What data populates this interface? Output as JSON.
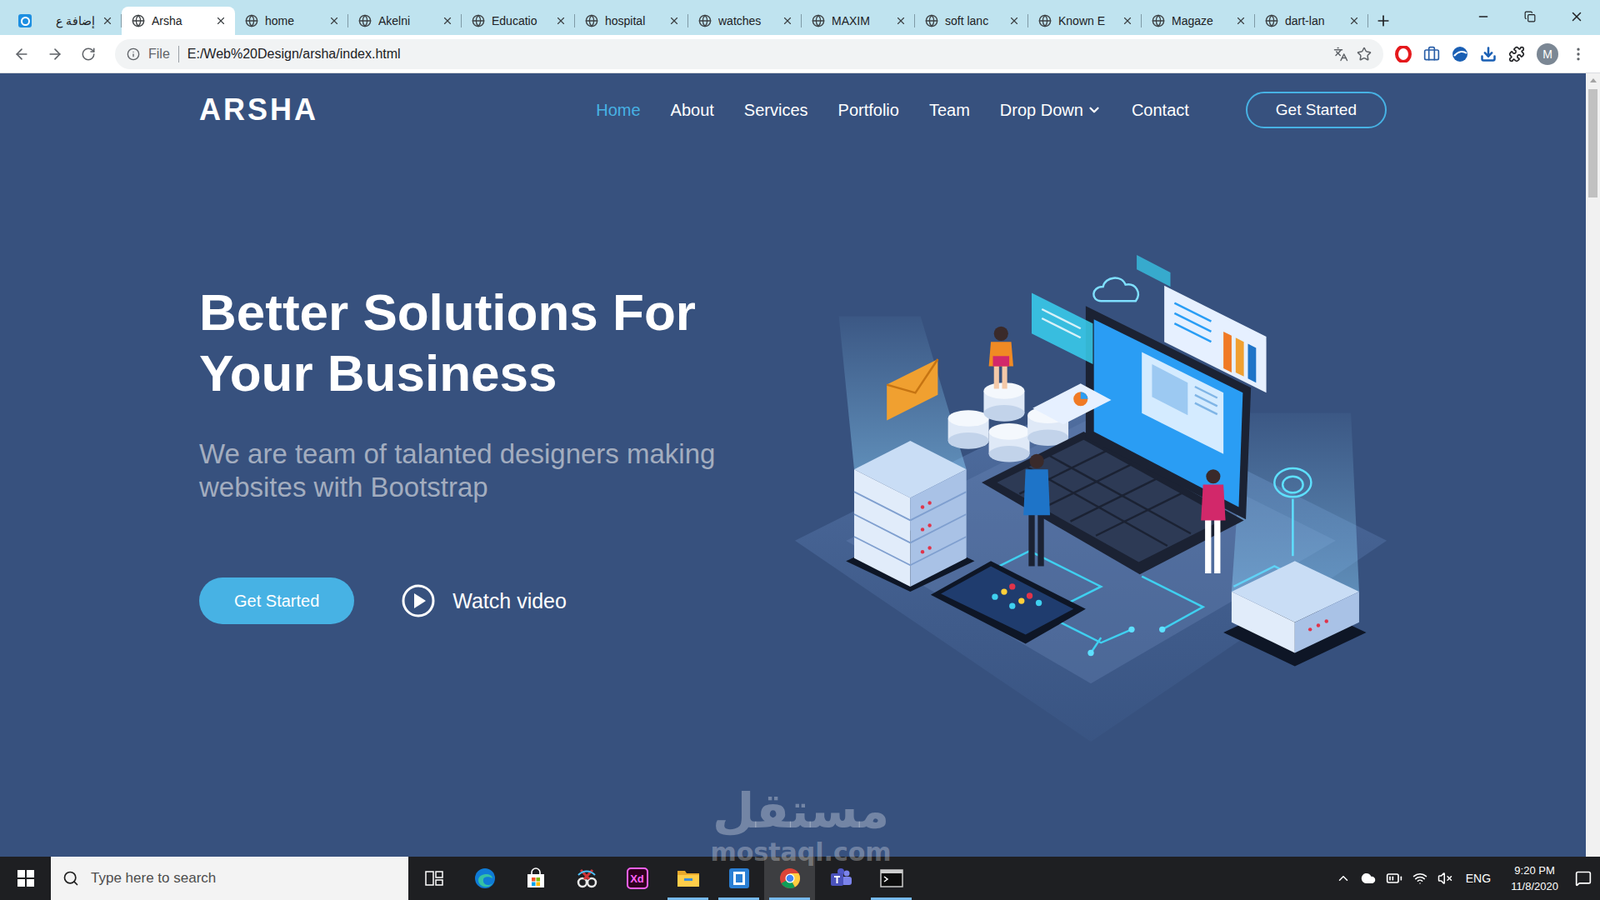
{
  "browser": {
    "tabs": [
      {
        "label": "إضافة ع",
        "kind": "app",
        "selected": false
      },
      {
        "label": "Arsha",
        "kind": "globe",
        "selected": true
      },
      {
        "label": "home",
        "kind": "globe",
        "selected": false
      },
      {
        "label": "Akelni",
        "kind": "globe",
        "selected": false
      },
      {
        "label": "Educatio",
        "kind": "globe",
        "selected": false
      },
      {
        "label": "hospital",
        "kind": "globe",
        "selected": false
      },
      {
        "label": "watches",
        "kind": "globe",
        "selected": false
      },
      {
        "label": "MAXIM",
        "kind": "globe",
        "selected": false
      },
      {
        "label": "soft lanc",
        "kind": "globe",
        "selected": false
      },
      {
        "label": "Known E",
        "kind": "globe",
        "selected": false
      },
      {
        "label": "Magaze",
        "kind": "globe",
        "selected": false
      },
      {
        "label": "dart-lan",
        "kind": "globe",
        "selected": false
      }
    ],
    "address": {
      "scheme": "File",
      "url": "E:/Web%20Design/arsha/index.html"
    },
    "profile": "M"
  },
  "page": {
    "logo": "ARSHA",
    "nav": [
      {
        "label": "Home",
        "selected": true,
        "dropdown": false
      },
      {
        "label": "About",
        "selected": false,
        "dropdown": false
      },
      {
        "label": "Services",
        "selected": false,
        "dropdown": false
      },
      {
        "label": "Portfolio",
        "selected": false,
        "dropdown": false
      },
      {
        "label": "Team",
        "selected": false,
        "dropdown": false
      },
      {
        "label": "Drop Down",
        "selected": false,
        "dropdown": true
      },
      {
        "label": "Contact",
        "selected": false,
        "dropdown": false
      }
    ],
    "header_button": "Get Started",
    "hero": {
      "title": "Better Solutions For Your Business",
      "subtitle": "We are team of talanted designers making websites with Bootstrap",
      "primary_button": "Get Started",
      "video_link": "Watch video"
    }
  },
  "taskbar": {
    "search_placeholder": "Type here to search",
    "apps": [
      {
        "kind": "edge",
        "label": "",
        "running": false,
        "selected": false
      },
      {
        "kind": "store",
        "label": "",
        "running": false,
        "selected": false
      },
      {
        "kind": "snip",
        "label": "",
        "running": false,
        "selected": false
      },
      {
        "kind": "xd",
        "label": "Xd",
        "running": false,
        "selected": false
      },
      {
        "kind": "explorer",
        "label": "",
        "running": true,
        "selected": false
      },
      {
        "kind": "app",
        "label": "",
        "running": true,
        "selected": false
      },
      {
        "kind": "chrome",
        "label": "",
        "running": true,
        "selected": true
      },
      {
        "kind": "teams",
        "label": "",
        "running": false,
        "selected": false
      },
      {
        "kind": "terminal",
        "label": "",
        "running": true,
        "selected": false
      }
    ],
    "language": "ENG",
    "time": "9:20 PM",
    "date": "11/8/2020"
  },
  "watermark": {
    "arabic": "مستقل",
    "latin": "mostaql.com"
  }
}
